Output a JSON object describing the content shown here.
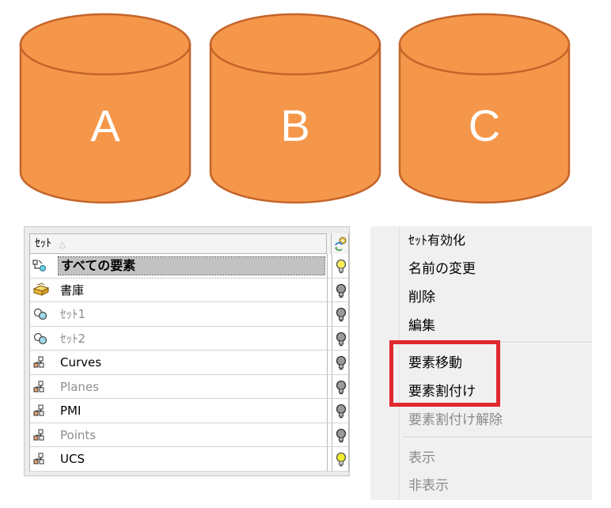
{
  "cylinders": [
    {
      "label": "A"
    },
    {
      "label": "B"
    },
    {
      "label": "C"
    }
  ],
  "colors": {
    "cylinder_fill": "#f5974a",
    "cylinder_stroke": "#c4642a",
    "highlight": "#e0282f"
  },
  "set_tree": {
    "header": {
      "name_label": "ｾｯﾄ",
      "sort_glyph": "△",
      "visibility_icon": "refresh-gear-icon"
    },
    "rows": [
      {
        "label": "すべての要素",
        "icon": "all-elements-icon",
        "selected": true,
        "dim": false,
        "bulb": "on"
      },
      {
        "label": "書庫",
        "icon": "library-icon",
        "selected": false,
        "dim": false,
        "bulb": "off"
      },
      {
        "label": "ｾｯﾄ1",
        "icon": "set-icon",
        "selected": false,
        "dim": true,
        "bulb": "off"
      },
      {
        "label": "ｾｯﾄ2",
        "icon": "set-icon",
        "selected": false,
        "dim": true,
        "bulb": "off"
      },
      {
        "label": "Curves",
        "icon": "layer-icon",
        "selected": false,
        "dim": false,
        "bulb": "off"
      },
      {
        "label": "Planes",
        "icon": "layer-icon",
        "selected": false,
        "dim": true,
        "bulb": "off"
      },
      {
        "label": "PMI",
        "icon": "layer-icon",
        "selected": false,
        "dim": false,
        "bulb": "off"
      },
      {
        "label": "Points",
        "icon": "layer-icon",
        "selected": false,
        "dim": true,
        "bulb": "off"
      },
      {
        "label": "UCS",
        "icon": "layer-icon",
        "selected": false,
        "dim": false,
        "bulb": "on"
      }
    ]
  },
  "context_menu": {
    "items": [
      {
        "label": "ｾｯﾄ有効化",
        "disabled": false
      },
      {
        "label": "名前の変更",
        "disabled": false
      },
      {
        "label": "削除",
        "disabled": false
      },
      {
        "label": "編集",
        "disabled": false
      },
      {
        "label": "要素移動",
        "disabled": false
      },
      {
        "label": "要素割付け",
        "disabled": false
      },
      {
        "label": "要素割付け解除",
        "disabled": true
      },
      {
        "label": "表示",
        "disabled": true
      },
      {
        "label": "非表示",
        "disabled": true
      }
    ]
  }
}
